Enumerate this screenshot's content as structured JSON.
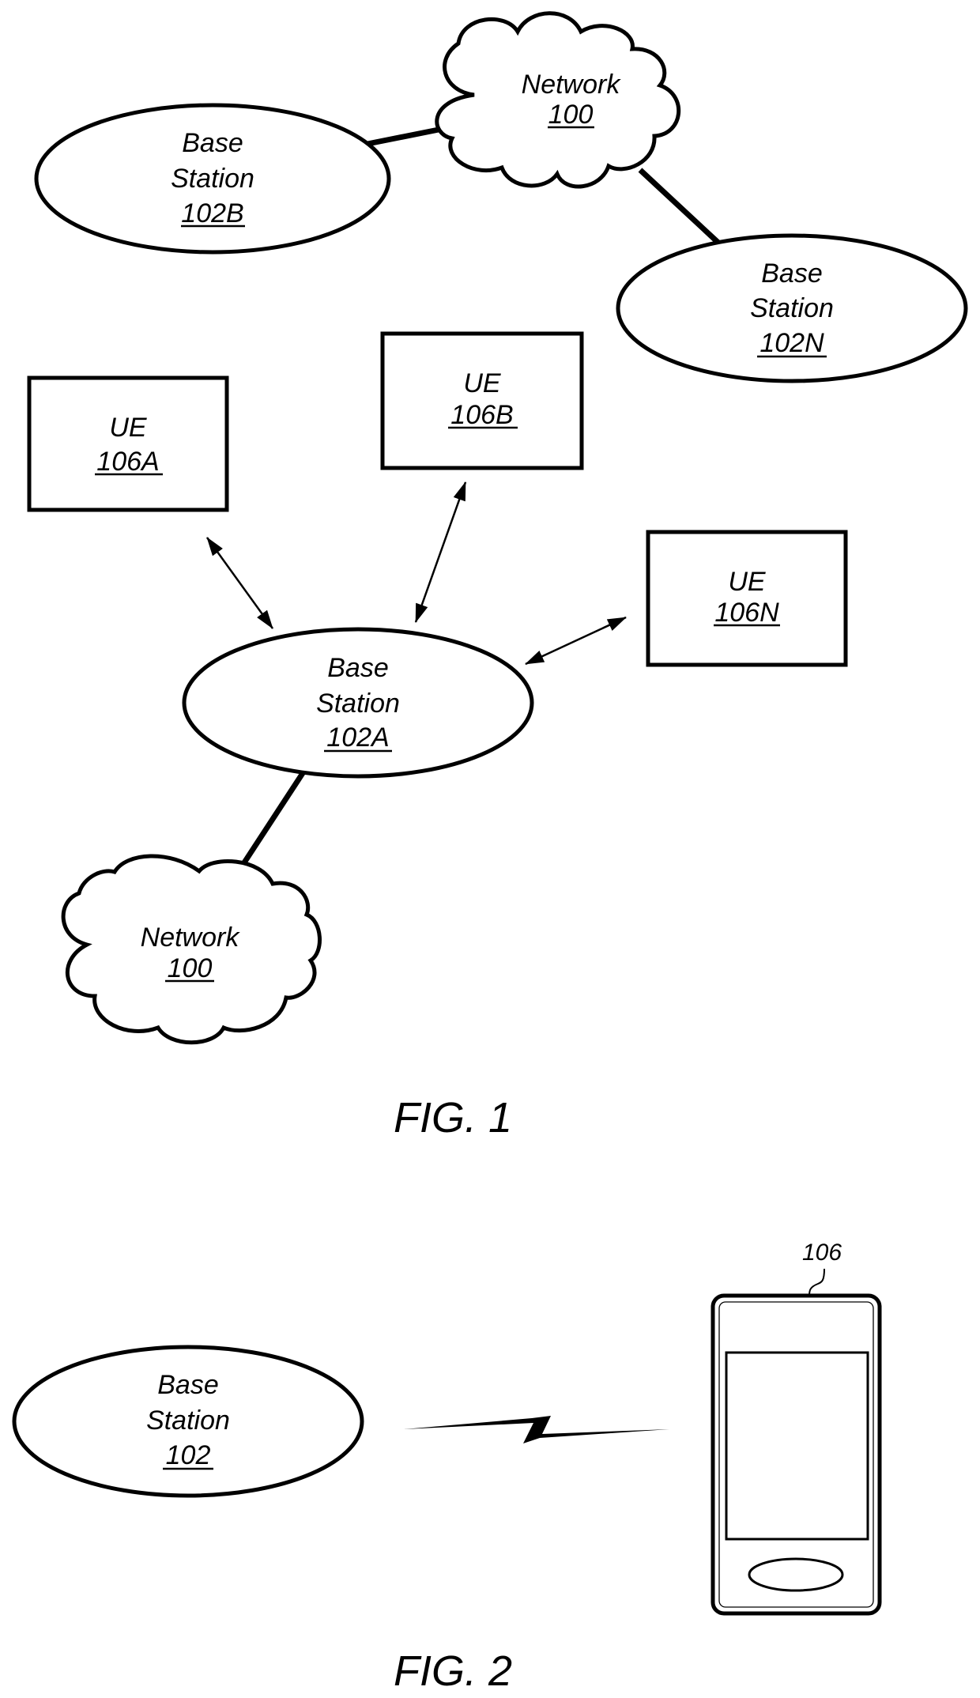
{
  "figures": [
    {
      "caption": "FIG. 1",
      "networks": [
        {
          "id": "network-top",
          "name": "Network",
          "ref": "100"
        },
        {
          "id": "network-bottom",
          "name": "Network",
          "ref": "100"
        }
      ],
      "base_stations": [
        {
          "id": "bs-102b",
          "line1": "Base",
          "line2": "Station",
          "ref": "102B"
        },
        {
          "id": "bs-102n",
          "line1": "Base",
          "line2": "Station",
          "ref": "102N"
        },
        {
          "id": "bs-102a",
          "line1": "Base",
          "line2": "Station",
          "ref": "102A"
        }
      ],
      "ues": [
        {
          "id": "ue-106a",
          "name": "UE",
          "ref": "106A"
        },
        {
          "id": "ue-106b",
          "name": "UE",
          "ref": "106B"
        },
        {
          "id": "ue-106n",
          "name": "UE",
          "ref": "106N"
        }
      ],
      "connections": [
        {
          "from": "102B",
          "to": "Network 100 (top)",
          "type": "wired"
        },
        {
          "from": "Network 100 (top)",
          "to": "102N",
          "type": "wired"
        },
        {
          "from": "102A",
          "to": "Network 100 (bottom)",
          "type": "wired"
        },
        {
          "from": "UE 106A",
          "to": "102A",
          "type": "wireless-bidirectional"
        },
        {
          "from": "UE 106B",
          "to": "102A",
          "type": "wireless-bidirectional"
        },
        {
          "from": "UE 106N",
          "to": "102A",
          "type": "wireless-bidirectional"
        }
      ]
    },
    {
      "caption": "FIG. 2",
      "base_station": {
        "line1": "Base",
        "line2": "Station",
        "ref": "102"
      },
      "device": {
        "ref": "106"
      },
      "link": "wireless"
    }
  ]
}
